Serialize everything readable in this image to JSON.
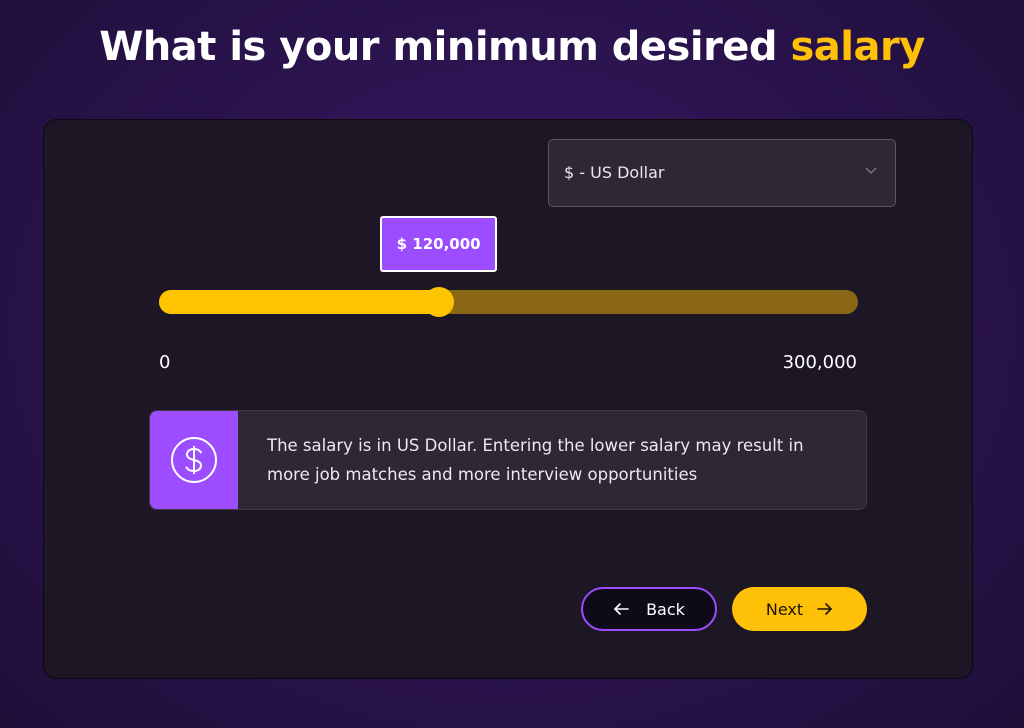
{
  "title": {
    "text": "What is your minimum desired",
    "highlight": "salary",
    "highlight_color": "#ffc107"
  },
  "currency_select": {
    "selected": "$ - US Dollar",
    "icon": "chevron-down-icon"
  },
  "slider": {
    "tooltip": "$ 120,000",
    "value": 120000,
    "min": 0,
    "max": 300000,
    "min_label": "0",
    "max_label": "300,000",
    "fill_color": "#ffc400",
    "track_color": "#8a6714"
  },
  "info": {
    "icon": "dollar-circle-icon",
    "text": "The salary is in US Dollar. Entering the lower salary may result in more job matches and more interview opportunities",
    "accent_color": "#9b4dff"
  },
  "buttons": {
    "back_label": "Back",
    "back_icon": "arrow-left-icon",
    "next_label": "Next",
    "next_icon": "arrow-right-icon"
  }
}
